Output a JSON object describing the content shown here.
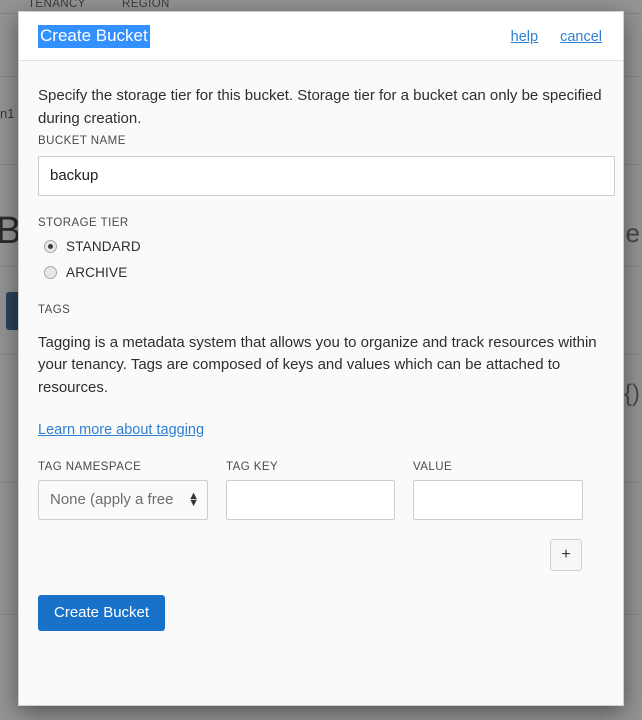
{
  "background": {
    "topbar": {
      "tenancy_label": "TENANCY",
      "region_label": "REGION"
    },
    "breadcrumb": "n1",
    "heading": "Bu",
    "primary_button": "",
    "right_fragment_1": "e",
    "right_fragment_2": "{)"
  },
  "modal": {
    "title": "Create Bucket",
    "title_selected": true,
    "links": {
      "help": "help",
      "cancel": "cancel"
    },
    "intro": "Specify the storage tier for this bucket. Storage tier for a bucket can only be specified during creation.",
    "bucket_name": {
      "label": "BUCKET NAME",
      "value": "backup",
      "placeholder": ""
    },
    "storage_tier": {
      "label": "STORAGE TIER",
      "selected": "STANDARD",
      "options": [
        {
          "label": "STANDARD",
          "checked": true
        },
        {
          "label": "ARCHIVE",
          "checked": false
        }
      ]
    },
    "tags": {
      "label": "TAGS",
      "description": "Tagging is a metadata system that allows you to organize and track resources within your tenancy. Tags are composed of keys and values which can be attached to resources.",
      "learn_more": "Learn more about tagging",
      "columns": {
        "namespace": "TAG NAMESPACE",
        "key": "TAG KEY",
        "value": "VALUE"
      },
      "row": {
        "namespace_value": "None (apply a free",
        "key_value": "",
        "key_placeholder": "",
        "value_value": "",
        "value_placeholder": ""
      },
      "add_button": "+"
    },
    "submit_button": "Create Bucket"
  },
  "colors": {
    "accent_blue": "#1872c9",
    "link_blue": "#2f7fd1",
    "selection_blue": "#3390ff",
    "modal_bg": "#fafafa",
    "header_bg": "#ffffff",
    "overlay": "rgba(60,60,60,0.55)"
  }
}
